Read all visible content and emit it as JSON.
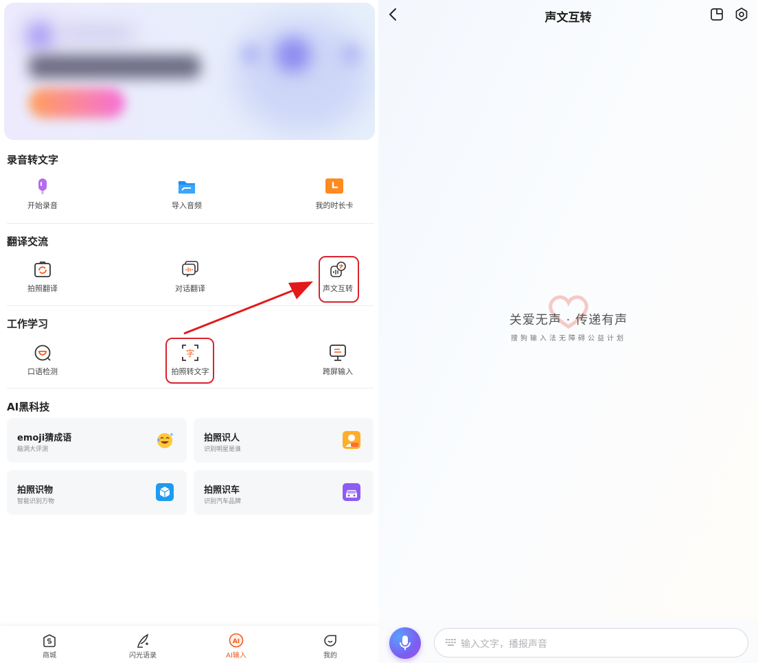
{
  "left": {
    "sections": [
      {
        "title": "录音转文字"
      },
      {
        "title": "翻译交流"
      },
      {
        "title": "工作学习"
      },
      {
        "title": "AI黑科技"
      }
    ],
    "recording_tools": [
      {
        "label": "开始录音",
        "icon": "microphone-icon"
      },
      {
        "label": "导入音频",
        "icon": "folder-icon"
      },
      {
        "label": "我的时长卡",
        "icon": "clock-card-icon"
      }
    ],
    "translate_tools": [
      {
        "label": "拍照翻译",
        "icon": "camera-translate-icon"
      },
      {
        "label": "对话翻译",
        "icon": "dialogue-translate-icon"
      },
      {
        "label": "声文互转",
        "icon": "voice-text-convert-icon"
      }
    ],
    "work_tools": [
      {
        "label": "口语检测",
        "icon": "speech-check-icon"
      },
      {
        "label": "拍照转文字",
        "icon": "photo-to-text-icon"
      },
      {
        "label": "跨屏输入",
        "icon": "cross-screen-icon"
      }
    ],
    "ai_cards": [
      {
        "title": "emoji猜成语",
        "subtitle": "脑洞大评测",
        "icon": "emoji-face-icon"
      },
      {
        "title": "拍照识人",
        "subtitle": "识别明星是谁",
        "icon": "face-id-icon"
      },
      {
        "title": "拍照识物",
        "subtitle": "智能识别万物",
        "icon": "cube-scan-icon"
      },
      {
        "title": "拍照识车",
        "subtitle": "识别汽车品牌",
        "icon": "car-icon"
      }
    ],
    "bottom_nav": [
      {
        "label": "商城",
        "icon": "shop-icon",
        "active": false
      },
      {
        "label": "闪光语录",
        "icon": "quill-icon",
        "active": false
      },
      {
        "label": "AI输入",
        "icon": "ai-input-icon",
        "active": true
      },
      {
        "label": "我的",
        "icon": "profile-icon",
        "active": false
      }
    ],
    "colors": {
      "accent": "#f25a1e",
      "highlight": "#d9232d"
    }
  },
  "right": {
    "title": "声文互转",
    "slogan": "关爱无声 · 传递有声",
    "slogan_sub": "搜狗输入法无障碍公益计划",
    "input": {
      "placeholder": "输入文字，播报声音"
    },
    "icons": [
      "back-icon",
      "window-icon",
      "settings-icon",
      "microphone-icon",
      "keyboard-icon"
    ]
  }
}
